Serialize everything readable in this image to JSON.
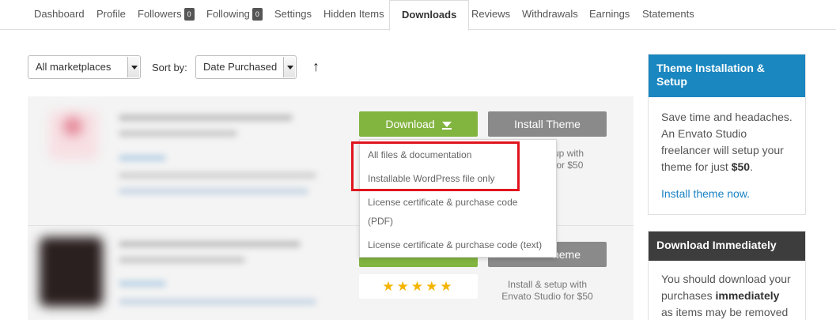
{
  "nav": {
    "items": [
      {
        "label": "Dashboard"
      },
      {
        "label": "Profile"
      },
      {
        "label": "Followers",
        "count": "0"
      },
      {
        "label": "Following",
        "count": "0"
      },
      {
        "label": "Settings"
      },
      {
        "label": "Hidden Items"
      },
      {
        "label": "Downloads",
        "active": true
      },
      {
        "label": "Reviews"
      },
      {
        "label": "Withdrawals"
      },
      {
        "label": "Earnings"
      },
      {
        "label": "Statements"
      }
    ]
  },
  "filters": {
    "marketplace_value": "All marketplaces",
    "sort_label": "Sort by:",
    "sort_value": "Date Purchased",
    "sort_direction_icon": "arrow-up-icon"
  },
  "items": [
    {
      "download_label": "Download",
      "install_label": "Install Theme",
      "install_note_partial": "etup with\no for $50"
    },
    {
      "install_label_partial": "heme",
      "install_note": "Install & setup with\nEnvato Studio for $50",
      "rating": "★★★★★"
    }
  ],
  "download_menu": {
    "options": [
      "All files & documentation",
      "Installable WordPress file only",
      "License certificate & purchase code\n(PDF)",
      "License certificate & purchase code (text)"
    ]
  },
  "sidebar": {
    "install_panel": {
      "title": "Theme Installation & Setup",
      "body_text": "Save time and headaches. An Envato Studio freelancer will setup your theme for just ",
      "price": "$50",
      "body_end": ".",
      "link": "Install theme now.",
      "color": "#1a87c0"
    },
    "download_panel": {
      "title": "Download Immediately",
      "body_text": "You should download your purchases ",
      "emphasis": "immediately",
      "body_end": " as items may be removed",
      "color": "#3d3d3d"
    }
  },
  "colors": {
    "accent_green": "#82b440",
    "button_grey": "#8a8a8a",
    "highlight_red": "#e0141e",
    "star_yellow": "#f4b400"
  }
}
